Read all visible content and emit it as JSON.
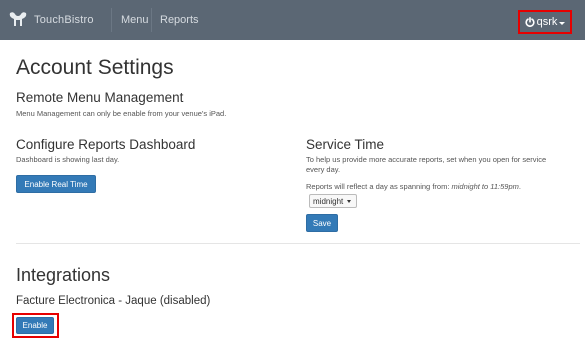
{
  "navbar": {
    "brand": "TouchBistro",
    "menu_label": "Menu",
    "reports_label": "Reports",
    "user_label": "qsrk",
    "background": "#5b6774"
  },
  "page": {
    "title": "Account Settings"
  },
  "remote_menu": {
    "title": "Remote Menu Management",
    "description": "Menu Management can only be enable from your venue's iPad."
  },
  "reports_dashboard": {
    "title": "Configure Reports Dashboard",
    "description": "Dashboard is showing last day.",
    "button_label": "Enable Real Time"
  },
  "service_time": {
    "title": "Service Time",
    "description_line1": "To help us provide more accurate reports, set when you open for service",
    "description_line2": "every day.",
    "reflect_prefix": "Reports will reflect a day as spanning from: ",
    "reflect_range": "midnight to 11:59pm",
    "reflect_suffix": ".",
    "select_value": "midnight",
    "save_label": "Save"
  },
  "integrations": {
    "title": "Integrations",
    "item_label": "Facture Electronica - Jaque (disabled)",
    "enable_label": "Enable"
  },
  "colors": {
    "primary_button": "#337ab7",
    "highlight": "#e60000"
  }
}
